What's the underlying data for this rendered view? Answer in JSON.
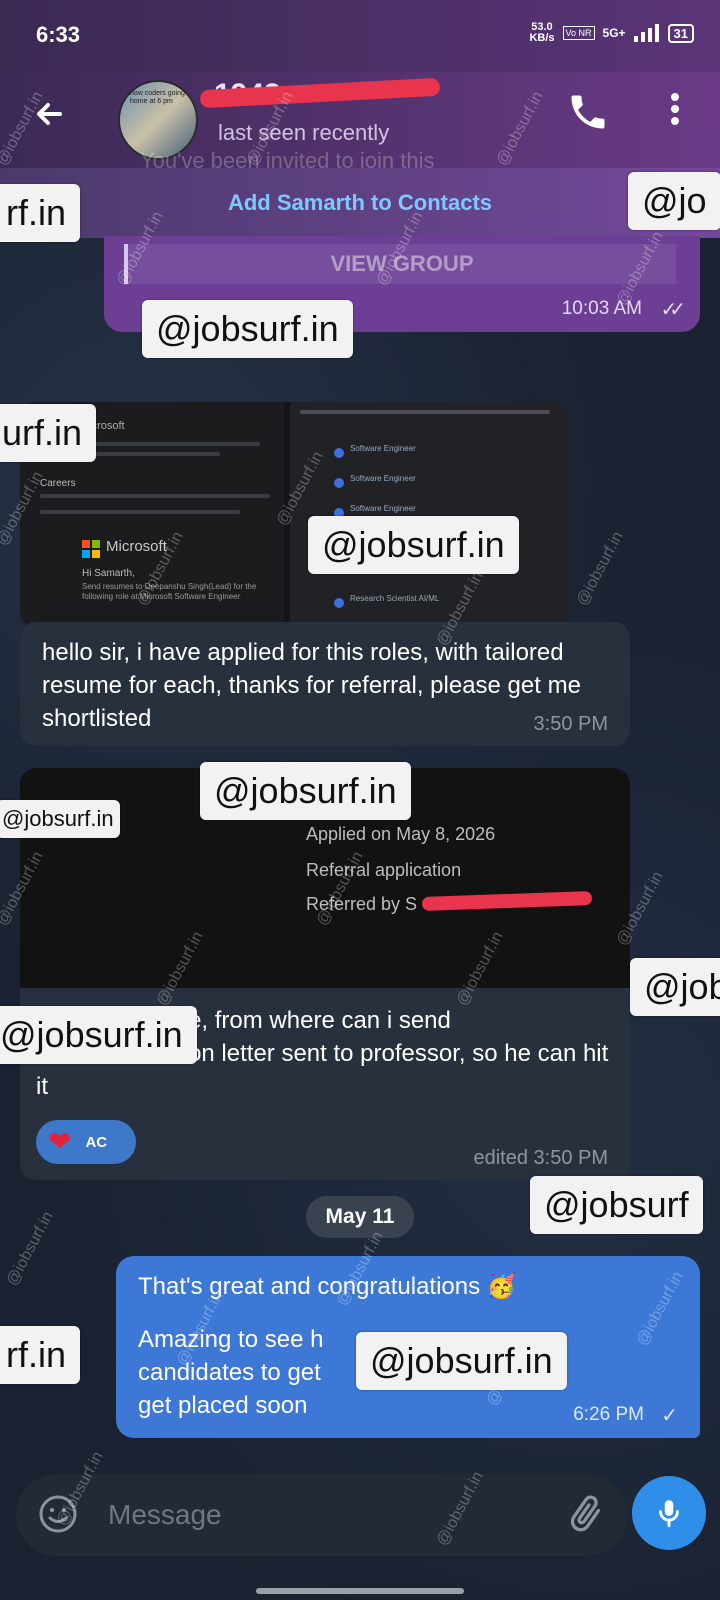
{
  "status_bar": {
    "time": "6:33",
    "net_speed_value": "53.0",
    "net_speed_unit": "KB/s",
    "volte": "Vo NR",
    "network": "5G+",
    "battery": "31"
  },
  "header": {
    "contact_name": "1943",
    "last_seen": "last seen recently",
    "avatar_text": "how coders going home at 6 pm"
  },
  "add_contact_label": "Add Samarth to Contacts",
  "ghost_text": "You've been invited to join this",
  "messages": {
    "group_invite": {
      "button": "VIEW GROUP",
      "time": "10:03 AM",
      "status": "✓✓"
    },
    "screenshot1": {
      "left_heading": "Microsoft",
      "left_section": "Careers",
      "left_hi": "Hi Samarth,",
      "left_body": "Send resumes to Deepanshu Singh(Lead) for the following role at Microsoft Software Engineer",
      "logo_text": "Microsoft",
      "right_rows": [
        "Software Engineer",
        "Software Engineer",
        "Software Engineer",
        "Research Scientist AI/ML"
      ]
    },
    "text1": {
      "text": "hello sir, i have applied for this roles, with tailored resume for each, thanks for referral, please get me shortlisted",
      "time": "3:50 PM"
    },
    "screenshot2": {
      "line1": "Applied on May 8, 2026",
      "line2": "Referral application",
      "line3": "Referred by S"
    },
    "text2": {
      "text": "and for this role, from where can i send recommendation letter sent to professor, so he can hit it",
      "reaction_emoji": "❤",
      "reaction_user": "AC",
      "edited": "edited 3:50 PM"
    },
    "date_divider": "May 11",
    "outgoing": {
      "line1": "That's great and congratulations 🥳",
      "line2": "Amazing to see how many candidates to get the interview, hope you get placed soon",
      "line2_visible_a": "Amazing to see h",
      "line2_visible_b": "candidates to get",
      "line2_visible_c": "get placed soon",
      "time": "6:26 PM",
      "status": "✓"
    }
  },
  "input": {
    "placeholder": "Message"
  },
  "watermark": {
    "small": "@iobsurf.in",
    "large": "@jobsurf.in",
    "partial_a": "rf.in",
    "partial_b": "urf.in",
    "partial_c": "@jo",
    "partial_d": "@job",
    "partial_e": "@jobsurf",
    "partial_f": "@jobsurf.in"
  },
  "colors": {
    "header_gradient_start": "#3b2a55",
    "header_gradient_end": "#6a3a86",
    "outgoing_bubble": "#3d78d6",
    "incoming_bubble": "#28303d",
    "mic_button": "#2f8fe8",
    "link_blue": "#7ec7ff",
    "redaction": "#e8354d"
  }
}
